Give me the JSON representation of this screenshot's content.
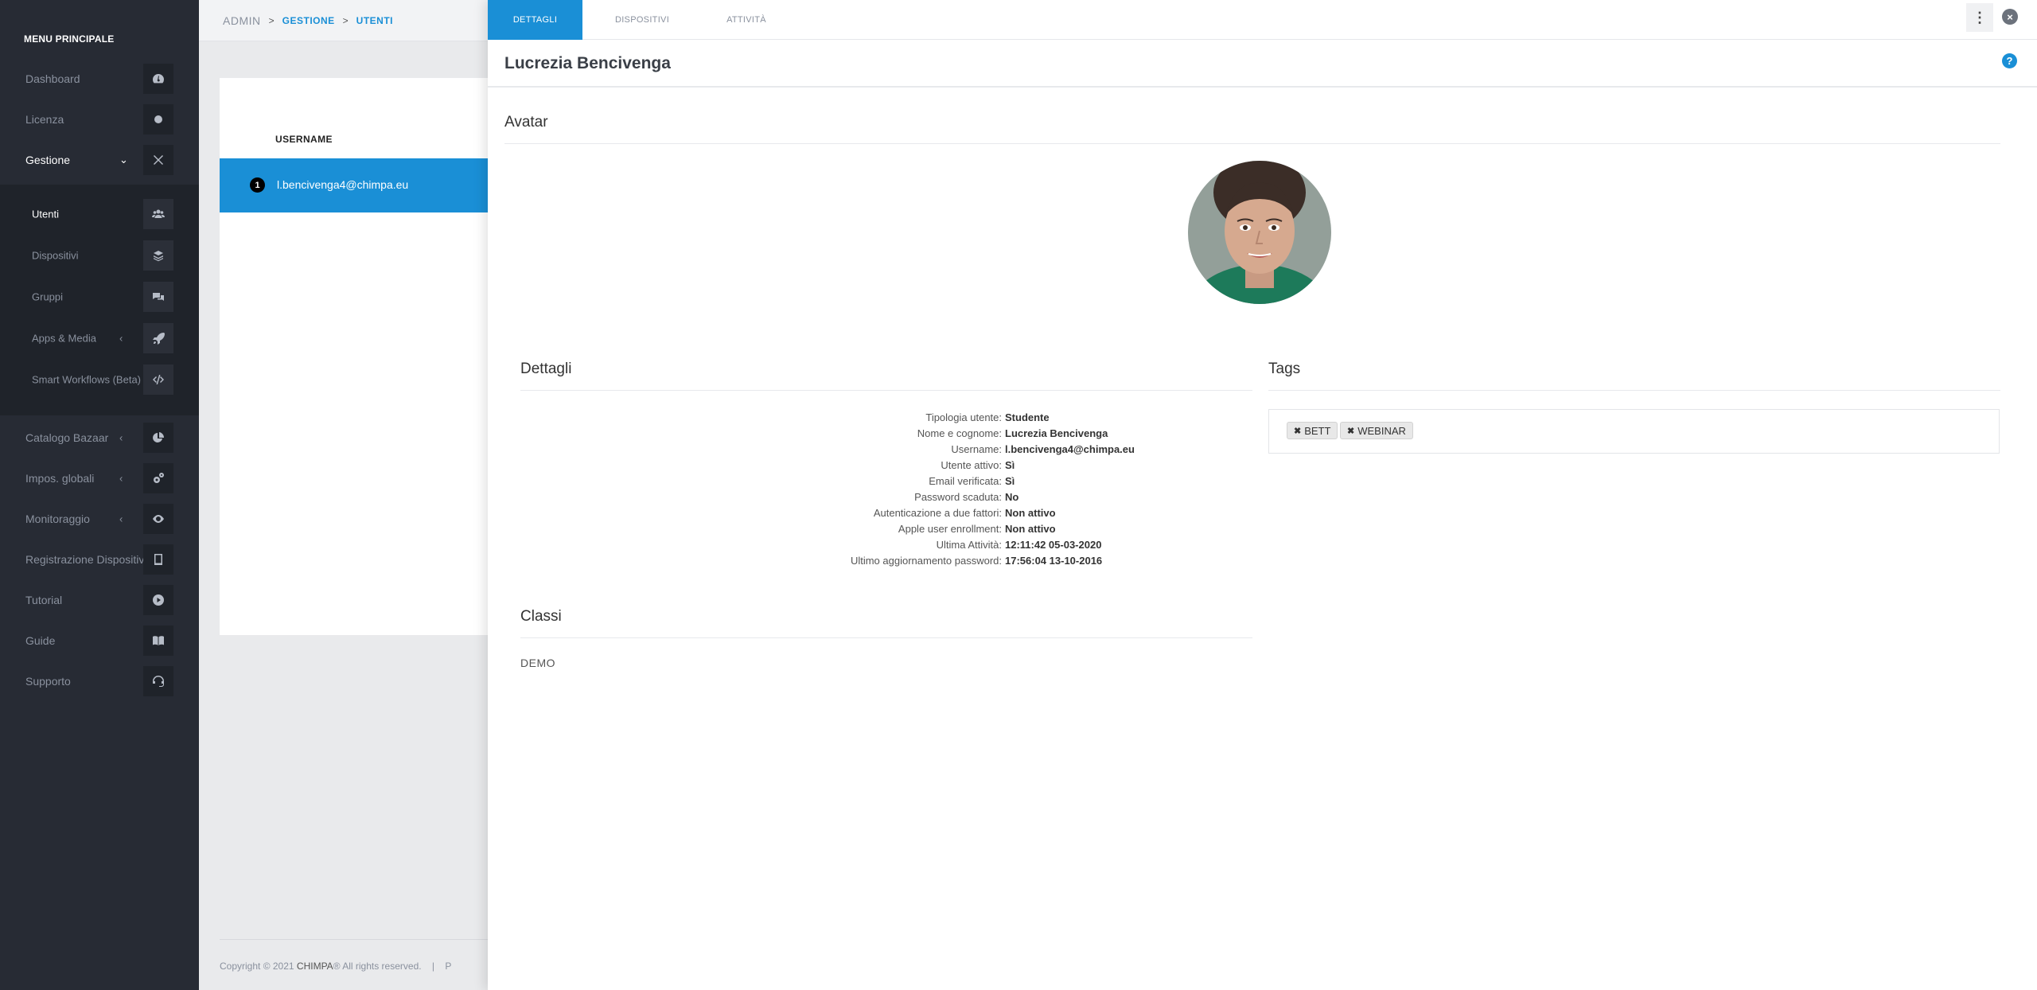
{
  "sidebar": {
    "title": "MENU PRINCIPALE",
    "items": [
      {
        "label": "Dashboard",
        "icon": "dashboard-icon"
      },
      {
        "label": "Licenza",
        "icon": "circle-icon"
      },
      {
        "label": "Gestione",
        "icon": "tools-icon"
      }
    ],
    "submenu": [
      {
        "label": "Utenti",
        "icon": "users-icon"
      },
      {
        "label": "Dispositivi",
        "icon": "layers-icon"
      },
      {
        "label": "Gruppi",
        "icon": "chat-icon"
      },
      {
        "label": "Apps & Media",
        "icon": "rocket-icon"
      },
      {
        "label": "Smart Workflows (Beta)",
        "icon": "code-icon"
      }
    ],
    "items_after": [
      {
        "label": "Catalogo Bazaar",
        "icon": "pie-chart-icon"
      },
      {
        "label": "Impos. globali",
        "icon": "cogs-icon"
      },
      {
        "label": "Monitoraggio",
        "icon": "eye-icon"
      },
      {
        "label": "Registrazione Dispositivi",
        "icon": "tablet-icon"
      },
      {
        "label": "Tutorial",
        "icon": "play-icon"
      },
      {
        "label": "Guide",
        "icon": "book-icon"
      },
      {
        "label": "Supporto",
        "icon": "support-icon"
      }
    ]
  },
  "breadcrumb": {
    "root": "ADMIN",
    "level1": "GESTIONE",
    "level2": "UTENTI"
  },
  "user_list": {
    "column_header": "USERNAME",
    "rows": [
      {
        "index": "1",
        "username": "l.bencivenga4@chimpa.eu"
      }
    ]
  },
  "footer": {
    "copyright": "Copyright © 2021",
    "brand": "CHIMPA",
    "rights": "® All rights reserved.",
    "sep": "|",
    "more": "P"
  },
  "panel": {
    "tabs": [
      "DETTAGLI",
      "DISPOSITIVI",
      "ATTIVITÀ"
    ],
    "kebab": "⋮",
    "close": "×",
    "title": "Lucrezia Bencivenga",
    "help": "?",
    "avatar_section": "Avatar",
    "details_section": "Dettagli",
    "tags_section": "Tags",
    "classi_section": "Classi",
    "details": [
      {
        "key": "Tipologia utente:",
        "value": "Studente"
      },
      {
        "key": "Nome e cognome:",
        "value": "Lucrezia Bencivenga"
      },
      {
        "key": "Username:",
        "value": "l.bencivenga4@chimpa.eu"
      },
      {
        "key": "Utente attivo:",
        "value": "Sì"
      },
      {
        "key": "Email verificata:",
        "value": "Sì"
      },
      {
        "key": "Password scaduta:",
        "value": "No"
      },
      {
        "key": "Autenticazione a due fattori:",
        "value": "Non attivo"
      },
      {
        "key": "Apple user enrollment:",
        "value": "Non attivo"
      },
      {
        "key": "Ultima Attività:",
        "value": "12:11:42 05-03-2020"
      },
      {
        "key": "Ultimo aggiornamento password:",
        "value": "17:56:04 13-10-2016"
      }
    ],
    "tags": [
      "BETT",
      "WEBINAR"
    ],
    "classi": "DEMO"
  },
  "colors": {
    "accent": "#1a8fd6",
    "sidebar_bg": "#272b34"
  }
}
